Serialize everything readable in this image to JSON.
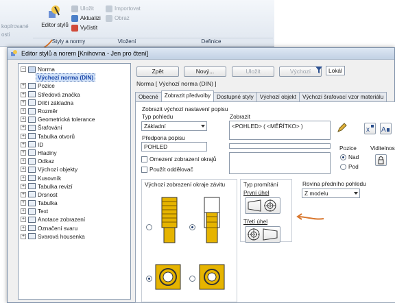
{
  "ribbon": {
    "left_labels": [
      "kopírované",
      "osti"
    ],
    "editor_label": "Editor stylů",
    "col1": [
      "Uložit",
      "Aktualizi",
      "Vyčistit"
    ],
    "col2": [
      "Importovat",
      "Obraz"
    ],
    "sections": [
      "Styly a normy",
      "Vložení",
      "Definice"
    ]
  },
  "dialog": {
    "title": "Editor stylů a norem [Knihovna - Jen pro čtení]"
  },
  "tree": {
    "root": "Norma",
    "selected": "Výchozí norma (DIN)",
    "items": [
      "Pozice",
      "Středová značka",
      "Dílčí základna",
      "Rozměr",
      "Geometrická tolerance",
      "Šrafování",
      "Tabulka otvorů",
      "ID",
      "Hladiny",
      "Odkaz",
      "Výchozí objekty",
      "Kusovník",
      "Tabulka revizí",
      "Drsnost",
      "Tabulka",
      "Text",
      "Anotace zobrazení",
      "Označení svaru",
      "Svarová housenka"
    ]
  },
  "toolbar": {
    "back": "Zpět",
    "new": "Nový...",
    "save": "Uložit",
    "default": "Výchozí",
    "local": "Lokál"
  },
  "header": "Norma [ Výchozí norma (DIN) ]",
  "tabs": [
    "Obecné",
    "Zobrazit předvolby",
    "Dostupné styly",
    "Výchozí objekt",
    "Výchozí šrafovací vzor materiálu"
  ],
  "panel": {
    "section_title": "Zobrazit výchozí nastavení popisu",
    "view_type_label": "Typ pohledu",
    "view_type_value": "Základní",
    "prefix_label": "Předpona popisu",
    "prefix_value": "POHLED",
    "chk_limit": "Omezení zobrazení okrajů",
    "chk_sep": "Použít oddělovač",
    "display_label": "Zobrazit",
    "display_value": "<POHLED> ( <MĚŘÍTKO> )",
    "position_label": "Pozice",
    "pos_above": "Nad",
    "pos_below": "Pod",
    "visibility_label": "Viditelnost",
    "thread_title": "Výchozí zobrazení okraje závitu",
    "projection_title": "Typ promítání",
    "first_angle": "První úhel",
    "third_angle": "Třetí úhel",
    "front_plane_label": "Rovina předního pohledu",
    "front_plane_value": "Z modelu"
  },
  "colors": {
    "accent_orange": "#d9772e",
    "thread_yellow": "#e6b400"
  }
}
